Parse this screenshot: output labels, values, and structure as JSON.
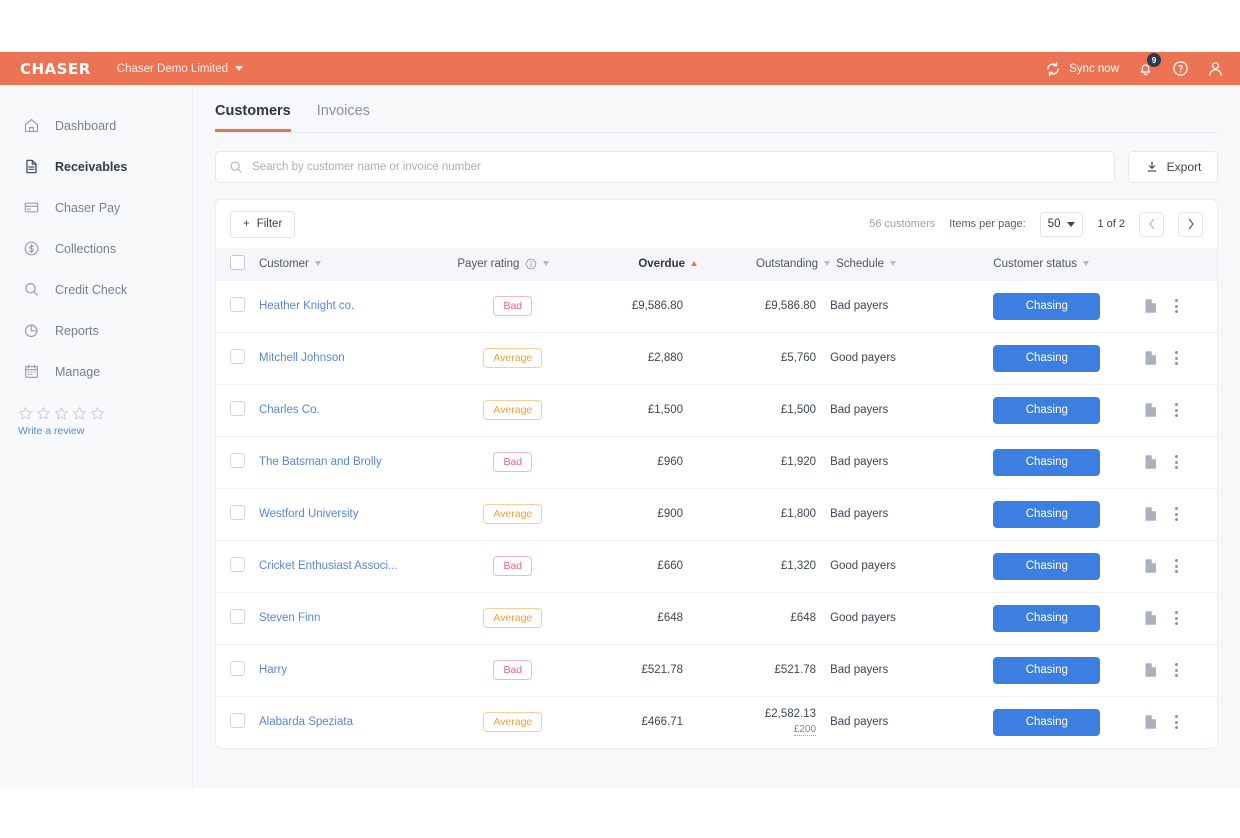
{
  "topbar": {
    "brand": "CHASER",
    "company": "Chaser Demo Limited",
    "sync_label": "Sync now",
    "notification_count": "9",
    "icons": {
      "sync": "sync-icon",
      "bell": "bell-icon",
      "help": "help-circle-icon",
      "account": "user-avatar-icon"
    },
    "accent_color": "#ec7354"
  },
  "sidebar": {
    "items": [
      {
        "label": "Dashboard",
        "icon": "home-icon",
        "active": false
      },
      {
        "label": "Receivables",
        "icon": "document-icon",
        "active": true
      },
      {
        "label": "Chaser Pay",
        "icon": "credit-card-icon",
        "active": false
      },
      {
        "label": "Collections",
        "icon": "dollar-circle-icon",
        "active": false
      },
      {
        "label": "Credit Check",
        "icon": "search-icon",
        "active": false
      },
      {
        "label": "Reports",
        "icon": "pie-chart-icon",
        "active": false
      },
      {
        "label": "Manage",
        "icon": "calendar-icon",
        "active": false
      }
    ],
    "review": {
      "stars_total": 5,
      "stars_filled": 0,
      "link_label": "Write a review"
    }
  },
  "main": {
    "tabs": [
      {
        "label": "Customers",
        "active": true
      },
      {
        "label": "Invoices",
        "active": false
      }
    ],
    "search": {
      "placeholder": "Search by customer name or invoice number",
      "value": ""
    },
    "export_label": "Export",
    "toolbar": {
      "filter_label": "Filter",
      "customer_count": "56 customers",
      "items_per_page_label": "Items per page:",
      "items_per_page_value": "50",
      "page_info": "1 of 2"
    },
    "table": {
      "columns": [
        {
          "key": "customer",
          "label": "Customer",
          "sorted": false,
          "info": false
        },
        {
          "key": "rating",
          "label": "Payer rating",
          "sorted": false,
          "info": true
        },
        {
          "key": "overdue",
          "label": "Overdue",
          "sorted": true,
          "info": false,
          "direction": "asc"
        },
        {
          "key": "outstanding",
          "label": "Outstanding",
          "sorted": false,
          "info": false
        },
        {
          "key": "schedule",
          "label": "Schedule",
          "sorted": false,
          "info": false
        },
        {
          "key": "status",
          "label": "Customer status",
          "sorted": false,
          "info": false
        }
      ],
      "rows": [
        {
          "customer": "Heather Knight co.",
          "rating": "Bad",
          "overdue": "£9,586.80",
          "outstanding": "£9,586.80",
          "outstanding_sub": "",
          "schedule": "Bad payers",
          "status": "Chasing"
        },
        {
          "customer": "Mitchell Johnson",
          "rating": "Average",
          "overdue": "£2,880",
          "outstanding": "£5,760",
          "outstanding_sub": "",
          "schedule": "Good payers",
          "status": "Chasing"
        },
        {
          "customer": "Charles Co.",
          "rating": "Average",
          "overdue": "£1,500",
          "outstanding": "£1,500",
          "outstanding_sub": "",
          "schedule": "Bad payers",
          "status": "Chasing"
        },
        {
          "customer": "The Batsman and Brolly",
          "rating": "Bad",
          "overdue": "£960",
          "outstanding": "£1,920",
          "outstanding_sub": "",
          "schedule": "Bad payers",
          "status": "Chasing"
        },
        {
          "customer": "Westford University",
          "rating": "Average",
          "overdue": "£900",
          "outstanding": "£1,800",
          "outstanding_sub": "",
          "schedule": "Bad payers",
          "status": "Chasing"
        },
        {
          "customer": "Cricket Enthusiast Associ...",
          "rating": "Bad",
          "overdue": "£660",
          "outstanding": "£1,320",
          "outstanding_sub": "",
          "schedule": "Good payers",
          "status": "Chasing"
        },
        {
          "customer": "Steven Finn",
          "rating": "Average",
          "overdue": "£648",
          "outstanding": "£648",
          "outstanding_sub": "",
          "schedule": "Good payers",
          "status": "Chasing"
        },
        {
          "customer": "Harry",
          "rating": "Bad",
          "overdue": "£521.78",
          "outstanding": "£521.78",
          "outstanding_sub": "",
          "schedule": "Bad payers",
          "status": "Chasing"
        },
        {
          "customer": "Alabarda Speziata",
          "rating": "Average",
          "overdue": "£466.71",
          "outstanding": "£2,582.13",
          "outstanding_sub": "£200",
          "schedule": "Bad payers",
          "status": "Chasing"
        }
      ],
      "row_icons": {
        "document": "file-icon",
        "menu": "kebab-menu-icon"
      }
    }
  },
  "colors": {
    "accent": "#ec7354",
    "primary_button": "#3d7fe0",
    "link": "#5b86d6",
    "bad": "#f2607a",
    "average": "#f0a03c"
  }
}
